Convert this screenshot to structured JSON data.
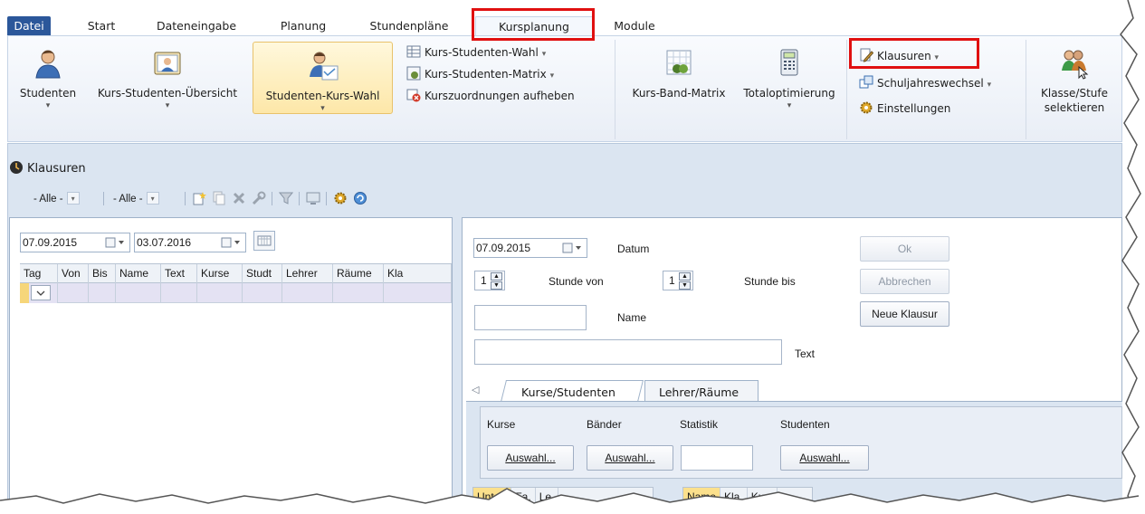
{
  "tabs": [
    "Datei",
    "Start",
    "Dateneingabe",
    "Planung",
    "Stundenpläne",
    "Kursplanung",
    "Module"
  ],
  "ribbon": {
    "large_buttons": {
      "studenten": "Studenten",
      "kurs_studenten_uebersicht": "Kurs-Studenten-Übersicht",
      "studenten_kurs_wahl": "Studenten-Kurs-Wahl",
      "kurs_band_matrix": "Kurs-Band-Matrix",
      "totaloptimierung": "Totaloptimierung",
      "klasse_stufe_line1": "Klasse/Stufe",
      "klasse_stufe_line2": "selektieren"
    },
    "small_buttons": {
      "kurs_studenten_wahl": "Kurs-Studenten-Wahl",
      "kurs_studenten_matrix": "Kurs-Studenten-Matrix",
      "kurszuordnungen_aufheben": "Kurszuordnungen aufheben",
      "klausuren": "Klausuren",
      "schuljahreswechsel": "Schuljahreswechsel",
      "einstellungen": "Einstellungen"
    },
    "dropdown_glyph": "▾"
  },
  "window": {
    "title": "Klausuren",
    "filter1": "- Alle -",
    "filter2": "- Alle -"
  },
  "left": {
    "date_from": "07.09.2015",
    "date_to": "03.07.2016",
    "columns": [
      "Tag",
      "Von",
      "Bis",
      "Name",
      "Text",
      "Kurse",
      "Studt",
      "Lehrer",
      "Räume",
      "Kla"
    ]
  },
  "form": {
    "date": "07.09.2015",
    "datum_label": "Datum",
    "stunde_von_value": "1",
    "stunde_von_label": "Stunde von",
    "stunde_bis_value": "1",
    "stunde_bis_label": "Stunde bis",
    "name_label": "Name",
    "text_label": "Text",
    "ok": "Ok",
    "abbrechen": "Abbrechen",
    "neue_klausur": "Neue Klausur"
  },
  "subtabs": [
    "Kurse/Studenten",
    "Lehrer/Räume"
  ],
  "sub": {
    "kurse": "Kurse",
    "baender": "Bänder",
    "statistik": "Statistik",
    "studenten": "Studenten",
    "auswahl": "Auswahl...",
    "grid1": [
      "Unterr",
      "Fa.",
      "Le."
    ],
    "grid2": [
      "Name",
      "Kla.",
      "Kurs"
    ]
  }
}
